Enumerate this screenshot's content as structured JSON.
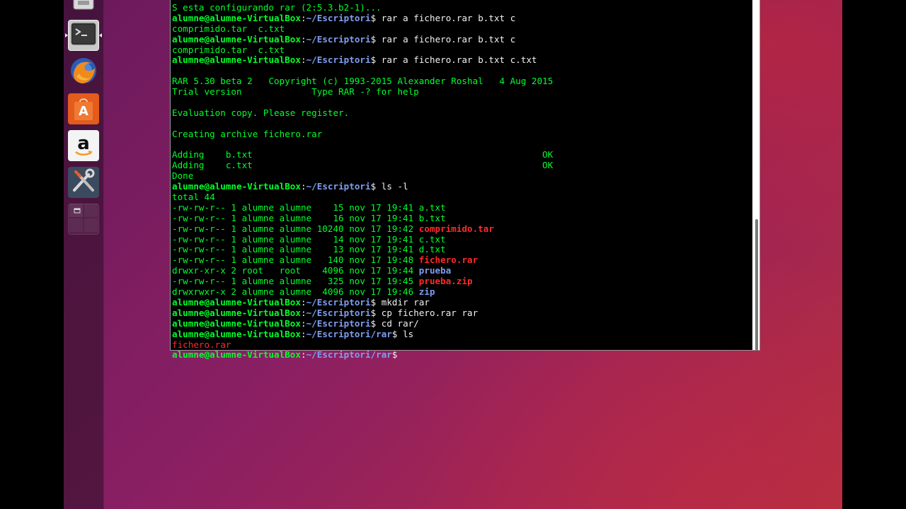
{
  "colors": {
    "prompt_user": "#00ff2a",
    "prompt_path": "#7e9ef2",
    "output": "#00ff2a",
    "archive_file": "#ff2a2a",
    "directory": "#7e9ef2"
  },
  "launcher": {
    "items": [
      {
        "name": "files",
        "icon": "file-cabinet-icon"
      },
      {
        "name": "terminal",
        "icon": "terminal-icon",
        "active": true
      },
      {
        "name": "firefox",
        "icon": "firefox-icon"
      },
      {
        "name": "software-center",
        "icon": "shopping-bag-icon",
        "glyph": "A"
      },
      {
        "name": "amazon",
        "icon": "amazon-icon",
        "glyph": "a"
      },
      {
        "name": "system-settings",
        "icon": "tools-icon"
      },
      {
        "name": "workspaces",
        "icon": "workspace-switcher-icon"
      }
    ]
  },
  "terminal": {
    "lines": [
      [
        {
          "t": "S esta configurando rar (2:5.3.b2-1)...",
          "c": "green"
        }
      ],
      [
        {
          "t": "alumne@alumne-VirtualBox",
          "c": "gb"
        },
        {
          "t": ":",
          "c": "white"
        },
        {
          "t": "~/Escriptori",
          "c": "blue"
        },
        {
          "t": "$ rar a fichero.rar b.txt c",
          "c": "white"
        }
      ],
      [
        {
          "t": "comprimido.tar  c.txt",
          "c": "green"
        }
      ],
      [
        {
          "t": "alumne@alumne-VirtualBox",
          "c": "gb"
        },
        {
          "t": ":",
          "c": "white"
        },
        {
          "t": "~/Escriptori",
          "c": "blue"
        },
        {
          "t": "$ rar a fichero.rar b.txt c",
          "c": "white"
        }
      ],
      [
        {
          "t": "comprimido.tar  c.txt",
          "c": "green"
        }
      ],
      [
        {
          "t": "alumne@alumne-VirtualBox",
          "c": "gb"
        },
        {
          "t": ":",
          "c": "white"
        },
        {
          "t": "~/Escriptori",
          "c": "blue"
        },
        {
          "t": "$ rar a fichero.rar b.txt c.txt",
          "c": "white"
        }
      ],
      [
        {
          "t": "",
          "c": "green"
        }
      ],
      [
        {
          "t": "RAR 5.30 beta 2   Copyright (c) 1993-2015 Alexander Roshal   4 Aug 2015",
          "c": "green"
        }
      ],
      [
        {
          "t": "Trial version             Type RAR -? for help",
          "c": "green"
        }
      ],
      [
        {
          "t": "",
          "c": "green"
        }
      ],
      [
        {
          "t": "Evaluation copy. Please register.",
          "c": "green"
        }
      ],
      [
        {
          "t": "",
          "c": "green"
        }
      ],
      [
        {
          "t": "Creating archive fichero.rar",
          "c": "green"
        }
      ],
      [
        {
          "t": "",
          "c": "green"
        }
      ],
      [
        {
          "t": "Adding    b.txt                                                      OK",
          "c": "green"
        }
      ],
      [
        {
          "t": "Adding    c.txt                                                      OK",
          "c": "green"
        }
      ],
      [
        {
          "t": "Done",
          "c": "green"
        }
      ],
      [
        {
          "t": "alumne@alumne-VirtualBox",
          "c": "gb"
        },
        {
          "t": ":",
          "c": "white"
        },
        {
          "t": "~/Escriptori",
          "c": "blue"
        },
        {
          "t": "$ ls -l",
          "c": "white"
        }
      ],
      [
        {
          "t": "total 44",
          "c": "green"
        }
      ],
      [
        {
          "t": "-rw-rw-r-- 1 alumne alumne    15 nov 17 19:41 a.txt",
          "c": "green"
        }
      ],
      [
        {
          "t": "-rw-rw-r-- 1 alumne alumne    16 nov 17 19:41 b.txt",
          "c": "green"
        }
      ],
      [
        {
          "t": "-rw-rw-r-- 1 alumne alumne 10240 nov 17 19:42 ",
          "c": "green"
        },
        {
          "t": "comprimido.tar",
          "c": "redb"
        }
      ],
      [
        {
          "t": "-rw-rw-r-- 1 alumne alumne    14 nov 17 19:41 c.txt",
          "c": "green"
        }
      ],
      [
        {
          "t": "-rw-rw-r-- 1 alumne alumne    13 nov 17 19:41 d.txt",
          "c": "green"
        }
      ],
      [
        {
          "t": "-rw-rw-r-- 1 alumne alumne   140 nov 17 19:48 ",
          "c": "green"
        },
        {
          "t": "fichero.rar",
          "c": "redb"
        }
      ],
      [
        {
          "t": "drwxr-xr-x 2 root   root    4096 nov 17 19:44 ",
          "c": "green"
        },
        {
          "t": "prueba",
          "c": "dir"
        }
      ],
      [
        {
          "t": "-rw-rw-r-- 1 alumne alumne   325 nov 17 19:45 ",
          "c": "green"
        },
        {
          "t": "prueba.zip",
          "c": "redb"
        }
      ],
      [
        {
          "t": "drwxrwxr-x 2 alumne alumne  4096 nov 17 19:46 ",
          "c": "green"
        },
        {
          "t": "zip",
          "c": "dir"
        }
      ],
      [
        {
          "t": "alumne@alumne-VirtualBox",
          "c": "gb"
        },
        {
          "t": ":",
          "c": "white"
        },
        {
          "t": "~/Escriptori",
          "c": "blue"
        },
        {
          "t": "$ mkdir rar",
          "c": "white"
        }
      ],
      [
        {
          "t": "alumne@alumne-VirtualBox",
          "c": "gb"
        },
        {
          "t": ":",
          "c": "white"
        },
        {
          "t": "~/Escriptori",
          "c": "blue"
        },
        {
          "t": "$ cp fichero.rar rar",
          "c": "white"
        }
      ],
      [
        {
          "t": "alumne@alumne-VirtualBox",
          "c": "gb"
        },
        {
          "t": ":",
          "c": "white"
        },
        {
          "t": "~/Escriptori",
          "c": "blue"
        },
        {
          "t": "$ cd rar/",
          "c": "white"
        }
      ],
      [
        {
          "t": "alumne@alumne-VirtualBox",
          "c": "gb"
        },
        {
          "t": ":",
          "c": "white"
        },
        {
          "t": "~/Escriptori/rar",
          "c": "blue"
        },
        {
          "t": "$ ls",
          "c": "white"
        }
      ],
      [
        {
          "t": "fichero.rar",
          "c": "red"
        }
      ],
      [
        {
          "t": "alumne@alumne-VirtualBox",
          "c": "gb"
        },
        {
          "t": ":",
          "c": "white"
        },
        {
          "t": "~/Escriptori/rar",
          "c": "blue"
        },
        {
          "t": "$ ",
          "c": "white"
        }
      ]
    ]
  }
}
